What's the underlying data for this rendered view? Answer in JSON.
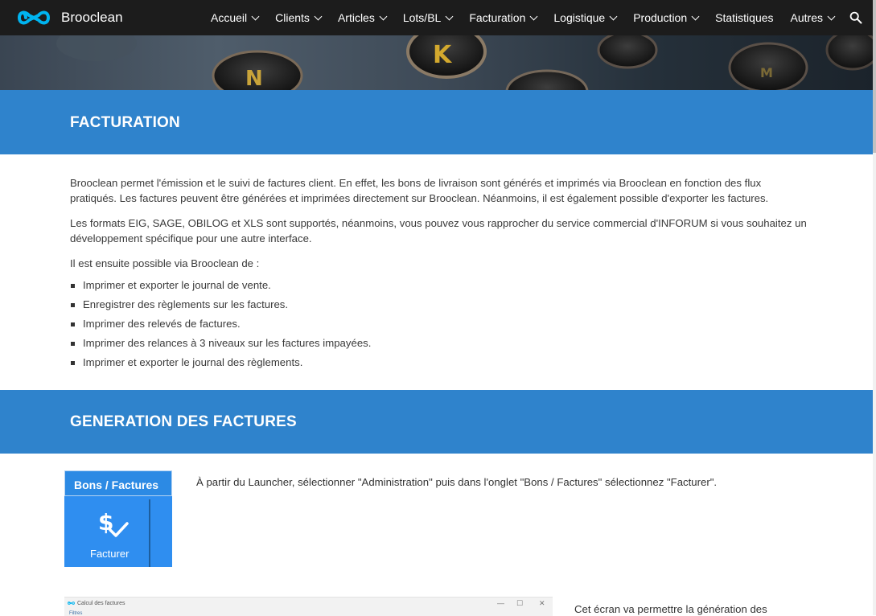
{
  "brand": {
    "name": "Brooclean",
    "accent_color": "#00b4f0",
    "logo_icon": "infinity-icon"
  },
  "nav": {
    "items": [
      {
        "label": "Accueil",
        "dropdown": true
      },
      {
        "label": "Clients",
        "dropdown": true
      },
      {
        "label": "Articles",
        "dropdown": true
      },
      {
        "label": "Lots/BL",
        "dropdown": true
      },
      {
        "label": "Facturation",
        "dropdown": true
      },
      {
        "label": "Logistique",
        "dropdown": true
      },
      {
        "label": "Production",
        "dropdown": true
      },
      {
        "label": "Statistiques",
        "dropdown": false
      },
      {
        "label": "Autres",
        "dropdown": true
      }
    ],
    "search_icon": "search-icon"
  },
  "colors": {
    "banner": "#2f83cc",
    "nav_bg": "#1c1c1c",
    "tile": "#2f8ef0"
  },
  "section1": {
    "title": "FACTURATION",
    "p1": "Brooclean permet l'émission et le suivi de factures client. En effet, les bons de livraison sont générés et imprimés via Brooclean en fonction des flux pratiqués. Les factures peuvent être générées et imprimées directement sur Brooclean. Néanmoins, il est également possible d'exporter les factures.",
    "p2": "Les formats EIG, SAGE, OBILOG et XLS sont supportés, néanmoins, vous pouvez vous rapprocher du service commercial d'INFORUM si vous souhaitez un développement spécifique pour une autre interface.",
    "p3": "Il est ensuite possible via Brooclean de :",
    "bullets": [
      "Imprimer et exporter le journal de vente.",
      "Enregistrer des règlements sur les factures.",
      "Imprimer des relevés de factures.",
      "Imprimer des relances à 3 niveaux sur les factures impayées.",
      "Imprimer et exporter le journal des règlements."
    ]
  },
  "section2": {
    "title": "GENERATION DES FACTURES",
    "tile": {
      "header": "Bons / Factures",
      "label": "Facturer",
      "icon": "dollar-check-icon"
    },
    "instruction": "À partir du Launcher, sélectionner \"Administration\" puis dans l'onglet \"Bons / Factures\" sélectionnez \"Facturer\".",
    "screenshot": {
      "window_title": "Calcul des factures",
      "filter_label": "Filtres",
      "controls": [
        "—",
        "☐",
        "✕"
      ]
    },
    "side_text": "Cet écran va permettre la génération des"
  }
}
